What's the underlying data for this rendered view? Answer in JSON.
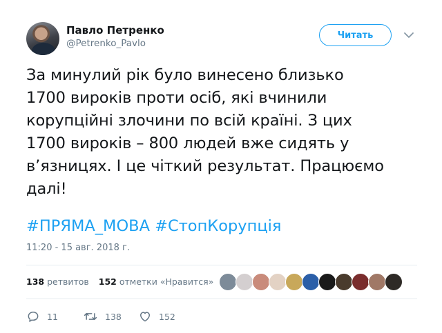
{
  "tweet": {
    "author_name": "Павло Петренко",
    "author_handle": "@Petrenko_Pavlo",
    "follow_label": "Читать",
    "text": "За минулий рік було винесено близько\n1700 вироків проти осіб, які вчинили\nкорупційні злочини по всій країні. З цих\n1700 вироків – 800 людей вже сидять у\nв’язницях. І це чіткий результат. Працюємо\nдалі!",
    "hashtags": [
      "#ПРЯМА_МОВА",
      "#СтопКорупція"
    ],
    "timestamp": "11:20 - 15 авг. 2018 г."
  },
  "stats": {
    "retweets_count": "138",
    "retweets_label": "ретвитов",
    "likes_count": "152",
    "likes_label": "отметки «Нравится»"
  },
  "likers": {
    "colors": [
      "#7d8b99",
      "#d4cfd0",
      "#c98b7b",
      "#e3d2c4",
      "#c8a85a",
      "#2b5fa8",
      "#1a1a1a",
      "#4a3b2d",
      "#7a2d2d",
      "#a07866",
      "#2e2a26"
    ]
  },
  "actions": {
    "reply_count": "11",
    "retweet_count": "138",
    "like_count": "152"
  }
}
